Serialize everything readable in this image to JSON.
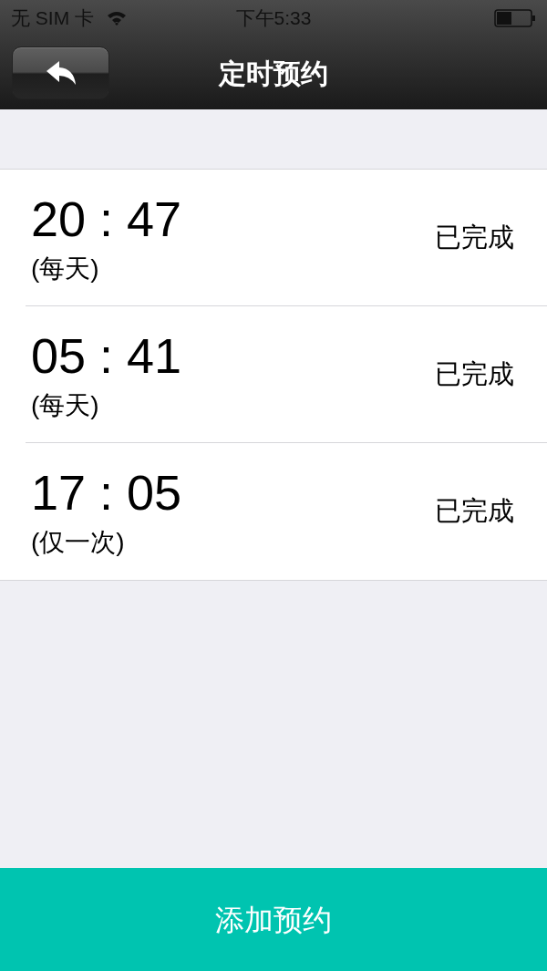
{
  "status_bar": {
    "carrier": "无 SIM 卡",
    "time": "下午5:33"
  },
  "nav_bar": {
    "title": "定时预约"
  },
  "schedules": [
    {
      "time": "20 : 47",
      "repeat": "(每天)",
      "status": "已完成"
    },
    {
      "time": "05 : 41",
      "repeat": "(每天)",
      "status": "已完成"
    },
    {
      "time": "17 : 05",
      "repeat": "(仅一次)",
      "status": "已完成"
    }
  ],
  "add_button": {
    "label": "添加预约"
  }
}
